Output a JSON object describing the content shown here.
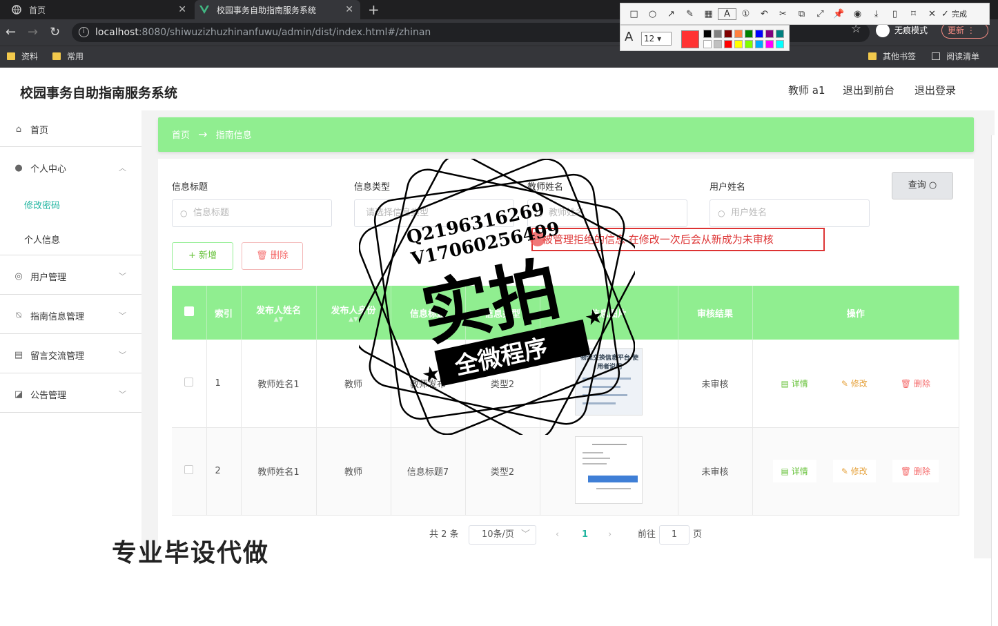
{
  "browser": {
    "tabs": [
      {
        "title": "首页",
        "active": false
      },
      {
        "title": "校园事务自助指南服务系统",
        "active": true
      }
    ],
    "url_host": "localhost",
    "url_path": ":8080/shiwuzizhuzhinanfuwu/admin/dist/index.html#/zhinan",
    "incognito_label": "无痕模式",
    "update_label": "更新",
    "bookmarks": [
      "资料",
      "常用"
    ],
    "bookmarks_right": [
      "其他书签",
      "阅读清单"
    ]
  },
  "annotation_toolbar": {
    "done_label": "完成",
    "font_size": "12",
    "current_color": "#ff3333",
    "palette": [
      "#000000",
      "#808080",
      "#800000",
      "#ff8040",
      "#008000",
      "#0000ff",
      "#800080",
      "#008080",
      "#ffffff",
      "#c0c0c0",
      "#ff0000",
      "#ffff00",
      "#80ff00",
      "#00aaff",
      "#ff00ff",
      "#00ffff"
    ]
  },
  "app": {
    "title": "校园事务自助指南服务系统",
    "user": "教师 a1",
    "to_front": "退出到前台",
    "logout": "退出登录"
  },
  "sidebar": {
    "items": [
      {
        "label": "首页",
        "icon": "home-icon"
      },
      {
        "label": "个人中心",
        "icon": "user-icon"
      },
      {
        "label": "用户管理",
        "icon": "compass-icon"
      },
      {
        "label": "指南信息管理",
        "icon": "bell-off-icon"
      },
      {
        "label": "留言交流管理",
        "icon": "printer-icon"
      },
      {
        "label": "公告管理",
        "icon": "chart-icon"
      }
    ],
    "subitems": [
      {
        "label": "修改密码",
        "active": true
      },
      {
        "label": "个人信息",
        "active": false
      }
    ]
  },
  "breadcrumb": {
    "home": "首页",
    "arrow": "→",
    "current": "指南信息"
  },
  "filters": [
    {
      "label": "信息标题",
      "placeholder": "信息标题"
    },
    {
      "label": "信息类型",
      "placeholder": "请选择信息类型"
    },
    {
      "label": "教师姓名",
      "placeholder": "教师姓名"
    },
    {
      "label": "用户姓名",
      "placeholder": "用户姓名"
    }
  ],
  "query_label": "查询",
  "add_label": "+ 新增",
  "delete_label": "删除",
  "tooltip": "被管理拒绝的信息 在修改一次后会从新成为未审核",
  "table": {
    "headers": [
      "索引",
      "发布人姓名",
      "发布人身份",
      "信息标题",
      "信息类型",
      "信息图片",
      "审核结果",
      "操作"
    ],
    "rows": [
      {
        "index": "1",
        "name": "教师姓名1",
        "role": "教师",
        "title": "教师发布",
        "type": "类型2",
        "result": "未审核"
      },
      {
        "index": "2",
        "name": "教师姓名1",
        "role": "教师",
        "title": "信息标题7",
        "type": "类型2",
        "result": "未审核"
      }
    ],
    "actions": {
      "detail": "详情",
      "edit": "修改",
      "remove": "删除"
    }
  },
  "pager": {
    "total": "共 2 条",
    "page_size": "10条/页",
    "current": "1",
    "goto": "前往",
    "goto_value": "1",
    "page_unit": "页"
  },
  "watermark": {
    "line1": "Q2196316269",
    "line2": "V17060256499",
    "big": "实拍",
    "banner": "全微程序",
    "bottom": "专业毕设代做"
  },
  "thumb1_caption": "物流交换信息平台 使用者说明"
}
